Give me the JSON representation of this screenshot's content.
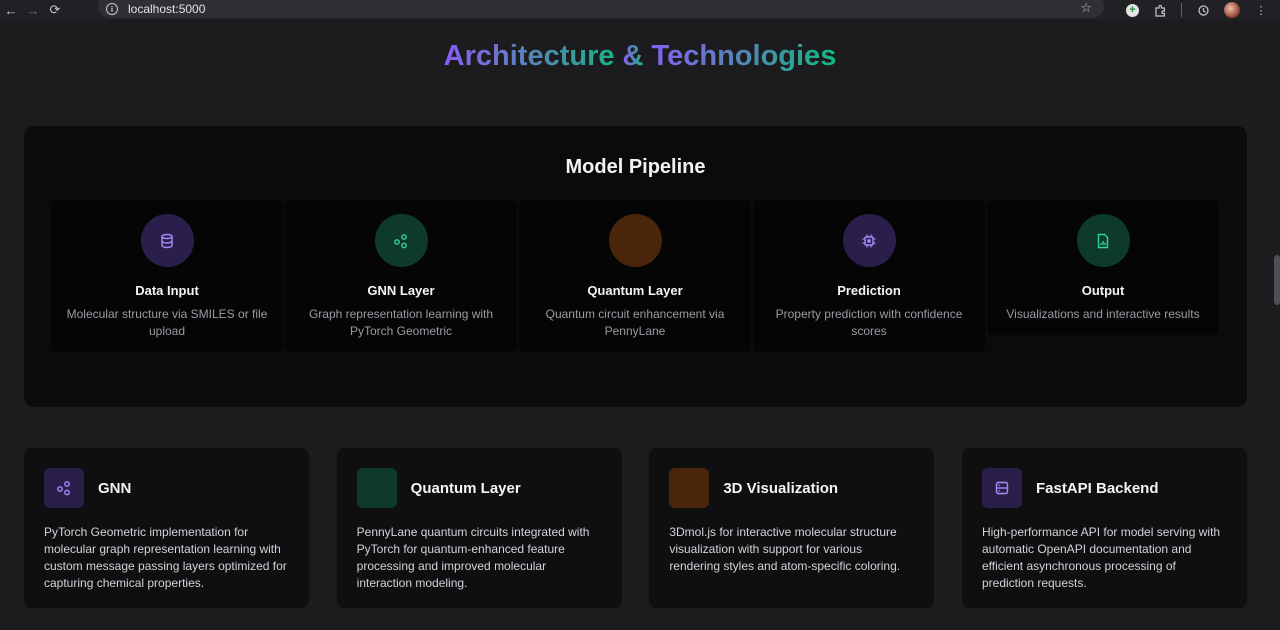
{
  "browser": {
    "url": "localhost:5000",
    "back_icon": "←",
    "forward_icon": "→",
    "reload_icon": "⟳",
    "star_icon": "☆",
    "menu_icon": "⋮"
  },
  "colors": {
    "purple": "#8b5cf6",
    "green": "#10b981",
    "orange": "#7c3a0d"
  },
  "section": {
    "title_part1": "Architecture ",
    "title_amp": "&",
    "title_part2": " Technologies"
  },
  "pipeline": {
    "title": "Model Pipeline",
    "steps": [
      {
        "name": "Data Input",
        "desc": "Molecular structure via SMILES or file upload",
        "icon": "database-icon"
      },
      {
        "name": "GNN Layer",
        "desc": "Graph representation learning with PyTorch Geometric",
        "icon": "graph-nodes-icon"
      },
      {
        "name": "Quantum Layer",
        "desc": "Quantum circuit enhancement via PennyLane",
        "icon": "quantum-icon"
      },
      {
        "name": "Prediction",
        "desc": "Property prediction with confidence scores",
        "icon": "cpu-icon"
      },
      {
        "name": "Output",
        "desc": "Visualizations and interactive results",
        "icon": "chart-file-icon"
      }
    ]
  },
  "tech": [
    {
      "name": "GNN",
      "desc": "PyTorch Geometric implementation for molecular graph representation learning with custom message passing layers optimized for capturing chemical properties.",
      "icon": "graph-nodes-icon"
    },
    {
      "name": "Quantum Layer",
      "desc": "PennyLane quantum circuits integrated with PyTorch for quantum-enhanced feature processing and improved molecular interaction modeling.",
      "icon": "quantum-icon"
    },
    {
      "name": "3D Visualization",
      "desc": "3Dmol.js for interactive molecular structure visualization with support for various rendering styles and atom-specific coloring.",
      "icon": "cube-icon"
    },
    {
      "name": "FastAPI Backend",
      "desc": "High-performance API for model serving with automatic OpenAPI documentation and efficient asynchronous processing of prediction requests.",
      "icon": "server-icon"
    }
  ]
}
